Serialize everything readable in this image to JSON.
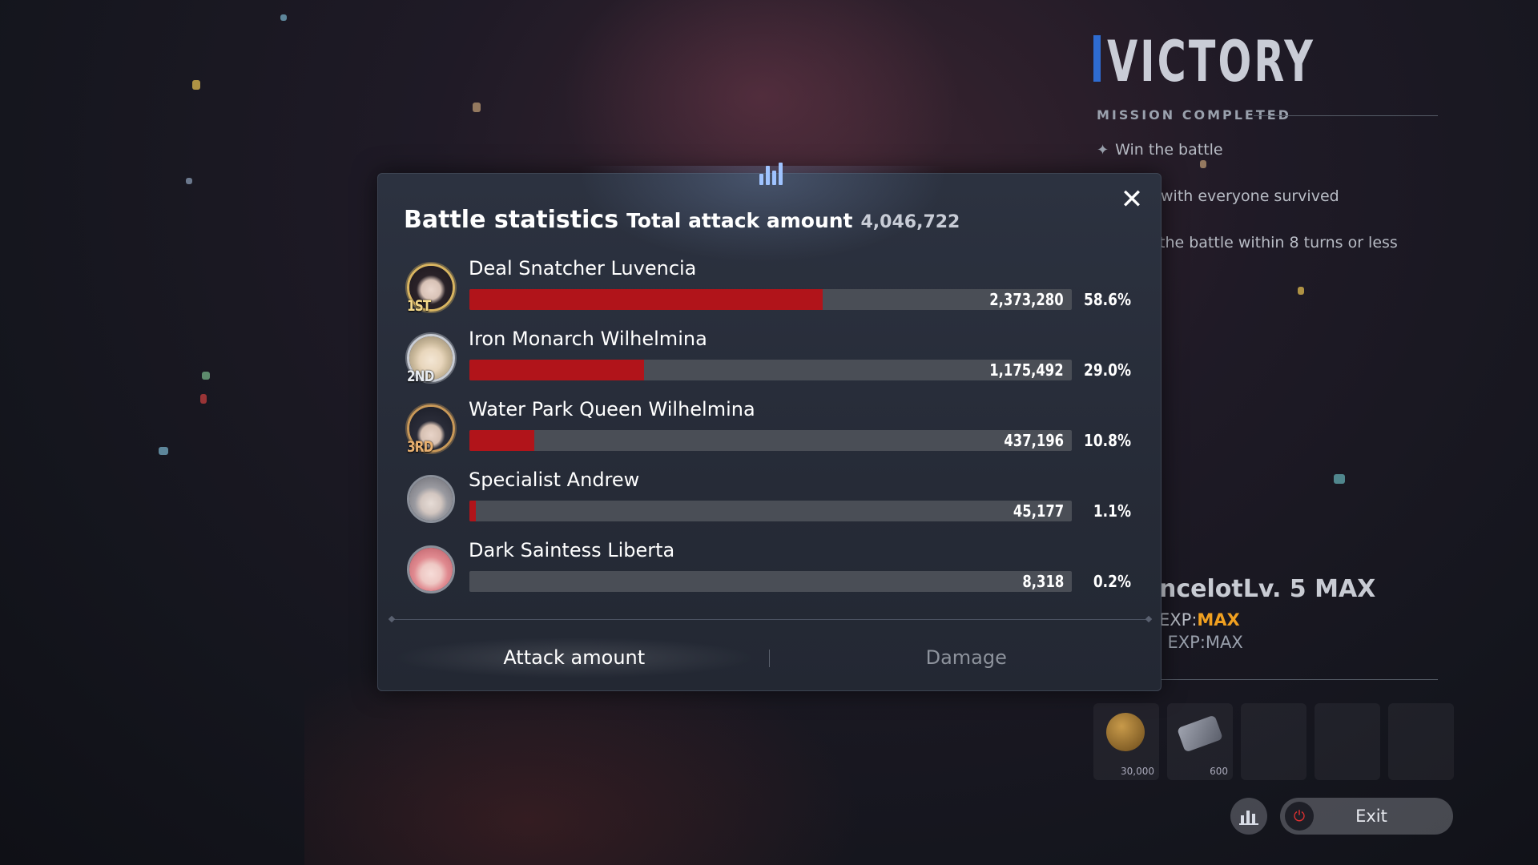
{
  "victory": {
    "title": "VICTORY",
    "mission_header": "MISSION COMPLETED",
    "missions": [
      "Win the battle",
      "with everyone survived",
      "the battle within 8 turns or less"
    ],
    "character_name": "ncelotLv. 5 MAX",
    "exp_prefix_1": "EXP:",
    "exp_value_1": "MAX",
    "exp_line_2": "l EXP:MAX",
    "rewards": [
      {
        "icon": "coin-icon",
        "count": "30,000"
      },
      {
        "icon": "ticket-icon",
        "count": "600"
      }
    ],
    "exit_label": "Exit"
  },
  "modal": {
    "title": "Battle statistics",
    "total_label": "Total attack amount",
    "total_value": "4,046,722",
    "close_label": "✕",
    "rows": [
      {
        "rank": "1ST",
        "name": "Deal Snatcher Luvencia",
        "value": "2,373,280",
        "percent": "58.6%",
        "fill": 0.586
      },
      {
        "rank": "2ND",
        "name": "Iron Monarch Wilhelmina",
        "value": "1,175,492",
        "percent": "29.0%",
        "fill": 0.29
      },
      {
        "rank": "3RD",
        "name": "Water Park Queen Wilhelmina",
        "value": "437,196",
        "percent": "10.8%",
        "fill": 0.108
      },
      {
        "rank": "",
        "name": "Specialist Andrew",
        "value": "45,177",
        "percent": "1.1%",
        "fill": 0.011
      },
      {
        "rank": "",
        "name": "Dark Saintess Liberta",
        "value": "8,318",
        "percent": "0.2%",
        "fill": 0.002
      }
    ],
    "tabs": [
      {
        "label": "Attack amount",
        "active": true
      },
      {
        "label": "Damage",
        "active": false
      }
    ]
  },
  "colors": {
    "bar_fill": "#b1141a",
    "bar_track": "#4a4e56",
    "accent_blue": "#2e6cd1",
    "exp_max": "#f0a020"
  }
}
